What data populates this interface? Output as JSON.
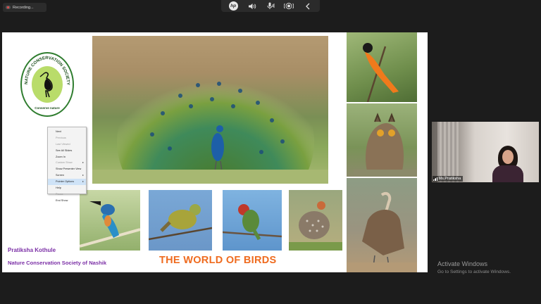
{
  "recording": {
    "label": "Recording..."
  },
  "toolbar": {
    "logo_text": "hp",
    "icons": [
      "speaker-icon",
      "microphone-icon",
      "broadcast-icon",
      "chevron-left-icon"
    ]
  },
  "slide": {
    "logo": {
      "text": "NATURE CONSERVATION SOCIETY OF NASHIK",
      "motto": "Conserve nature"
    },
    "presenter_name": "Pratiksha Kothule",
    "organization": "Nature Conservation Society of Nashik",
    "title": "THE WORLD OF BIRDS",
    "colors": {
      "name_text": "#7b2fa6",
      "title_text": "#ef6b1f"
    }
  },
  "context_menu": {
    "items": [
      {
        "label": "Next",
        "enabled": true,
        "submenu": false
      },
      {
        "label": "Previous",
        "enabled": false,
        "submenu": false
      },
      {
        "label": "Last Viewed",
        "enabled": false,
        "submenu": false
      },
      {
        "label": "See All Slides",
        "enabled": true,
        "submenu": false
      },
      {
        "label": "Zoom In",
        "enabled": true,
        "submenu": false
      },
      {
        "label": "Custom Show",
        "enabled": false,
        "submenu": true
      },
      {
        "label": "Show Presenter View",
        "enabled": true,
        "submenu": false
      },
      {
        "label": "Screen",
        "enabled": true,
        "submenu": true
      },
      {
        "label": "Pointer Options",
        "enabled": true,
        "submenu": true,
        "highlighted": true
      },
      {
        "label": "Help",
        "enabled": true,
        "submenu": false
      },
      {
        "label": "Pause",
        "enabled": false,
        "submenu": false
      },
      {
        "label": "End Show",
        "enabled": true,
        "submenu": false
      }
    ]
  },
  "participant": {
    "name": "Ms.Pratiksha"
  },
  "watermark": {
    "line1": "Activate Windows",
    "line2": "Go to Settings to activate Windows."
  }
}
